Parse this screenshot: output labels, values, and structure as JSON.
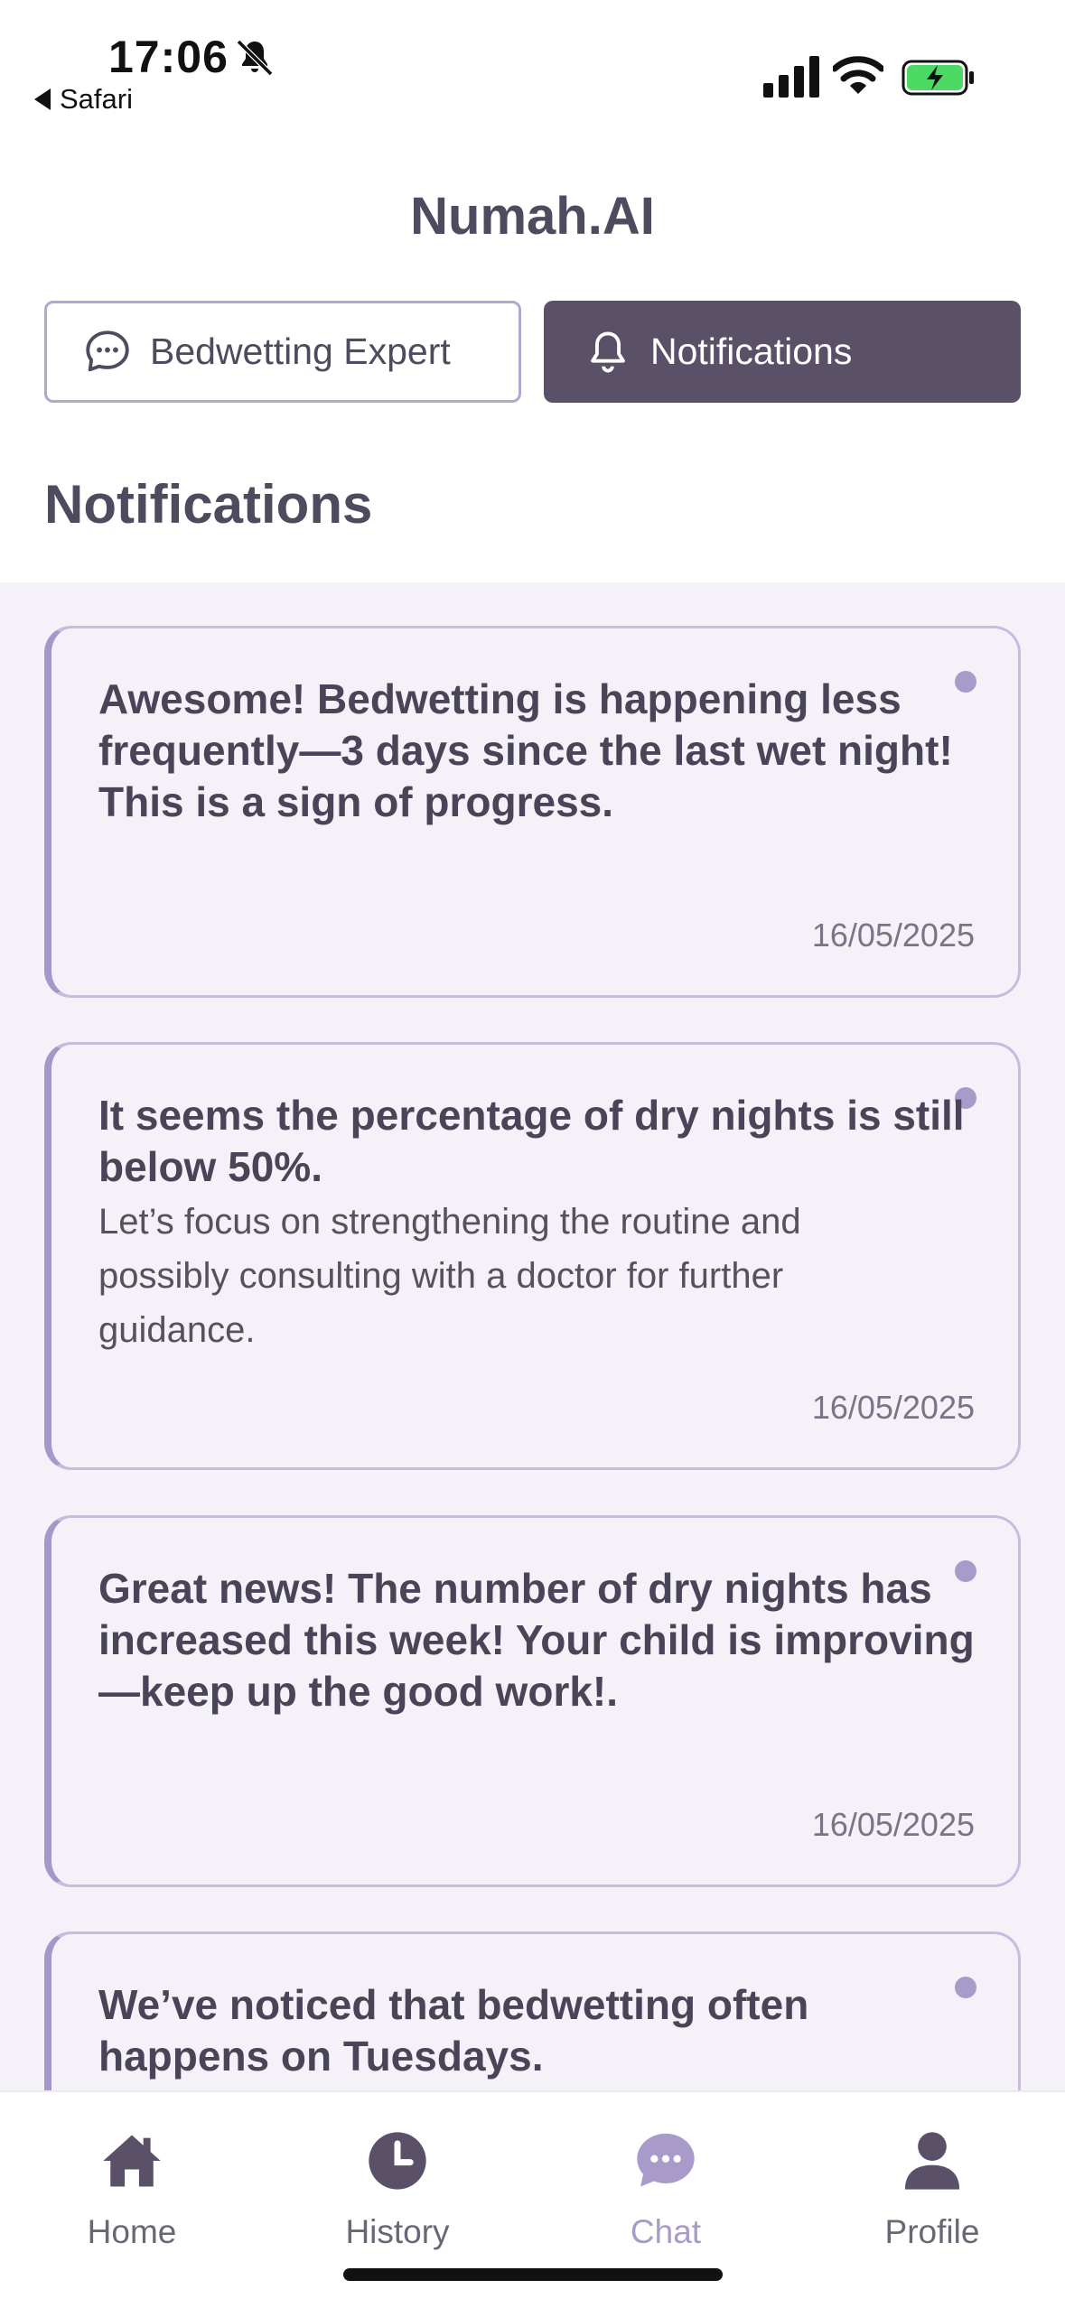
{
  "status_bar": {
    "time": "17:06",
    "back_app": "Safari"
  },
  "header": {
    "app_title": "Numah.AI",
    "tabs": [
      {
        "label": "Bedwetting Expert",
        "icon": "chat-bubble-icon",
        "active": false
      },
      {
        "label": "Notifications",
        "icon": "bell-icon",
        "active": true
      }
    ]
  },
  "section_title": "Notifications",
  "notifications": [
    {
      "title": "Awesome! Bedwetting is happening less frequently—3 days since the last wet night! This is a sign of progress.",
      "body": "",
      "date": "16/05/2025",
      "unread": true
    },
    {
      "title": "It seems the percentage of dry nights is still below 50%.",
      "body": "Let’s focus on strengthening the routine and possibly consulting with a doctor for further guidance.",
      "date": "16/05/2025",
      "unread": true
    },
    {
      "title": "Great news! The number of dry nights has increased this week! Your child is improving—keep up the good work!.",
      "body": "",
      "date": "16/05/2025",
      "unread": true
    },
    {
      "title": "We’ve noticed that bedwetting often happens on Tuesdays.",
      "body": "",
      "date": "",
      "unread": true
    }
  ],
  "bottom_nav": [
    {
      "label": "Home",
      "icon": "home-icon",
      "active": false
    },
    {
      "label": "History",
      "icon": "clock-icon",
      "active": false
    },
    {
      "label": "Chat",
      "icon": "chat-icon",
      "active": true
    },
    {
      "label": "Profile",
      "icon": "person-icon",
      "active": false
    }
  ],
  "colors": {
    "accent": "#a99bc9",
    "dark": "#5a5068",
    "list_background": "#f4f2f8"
  }
}
